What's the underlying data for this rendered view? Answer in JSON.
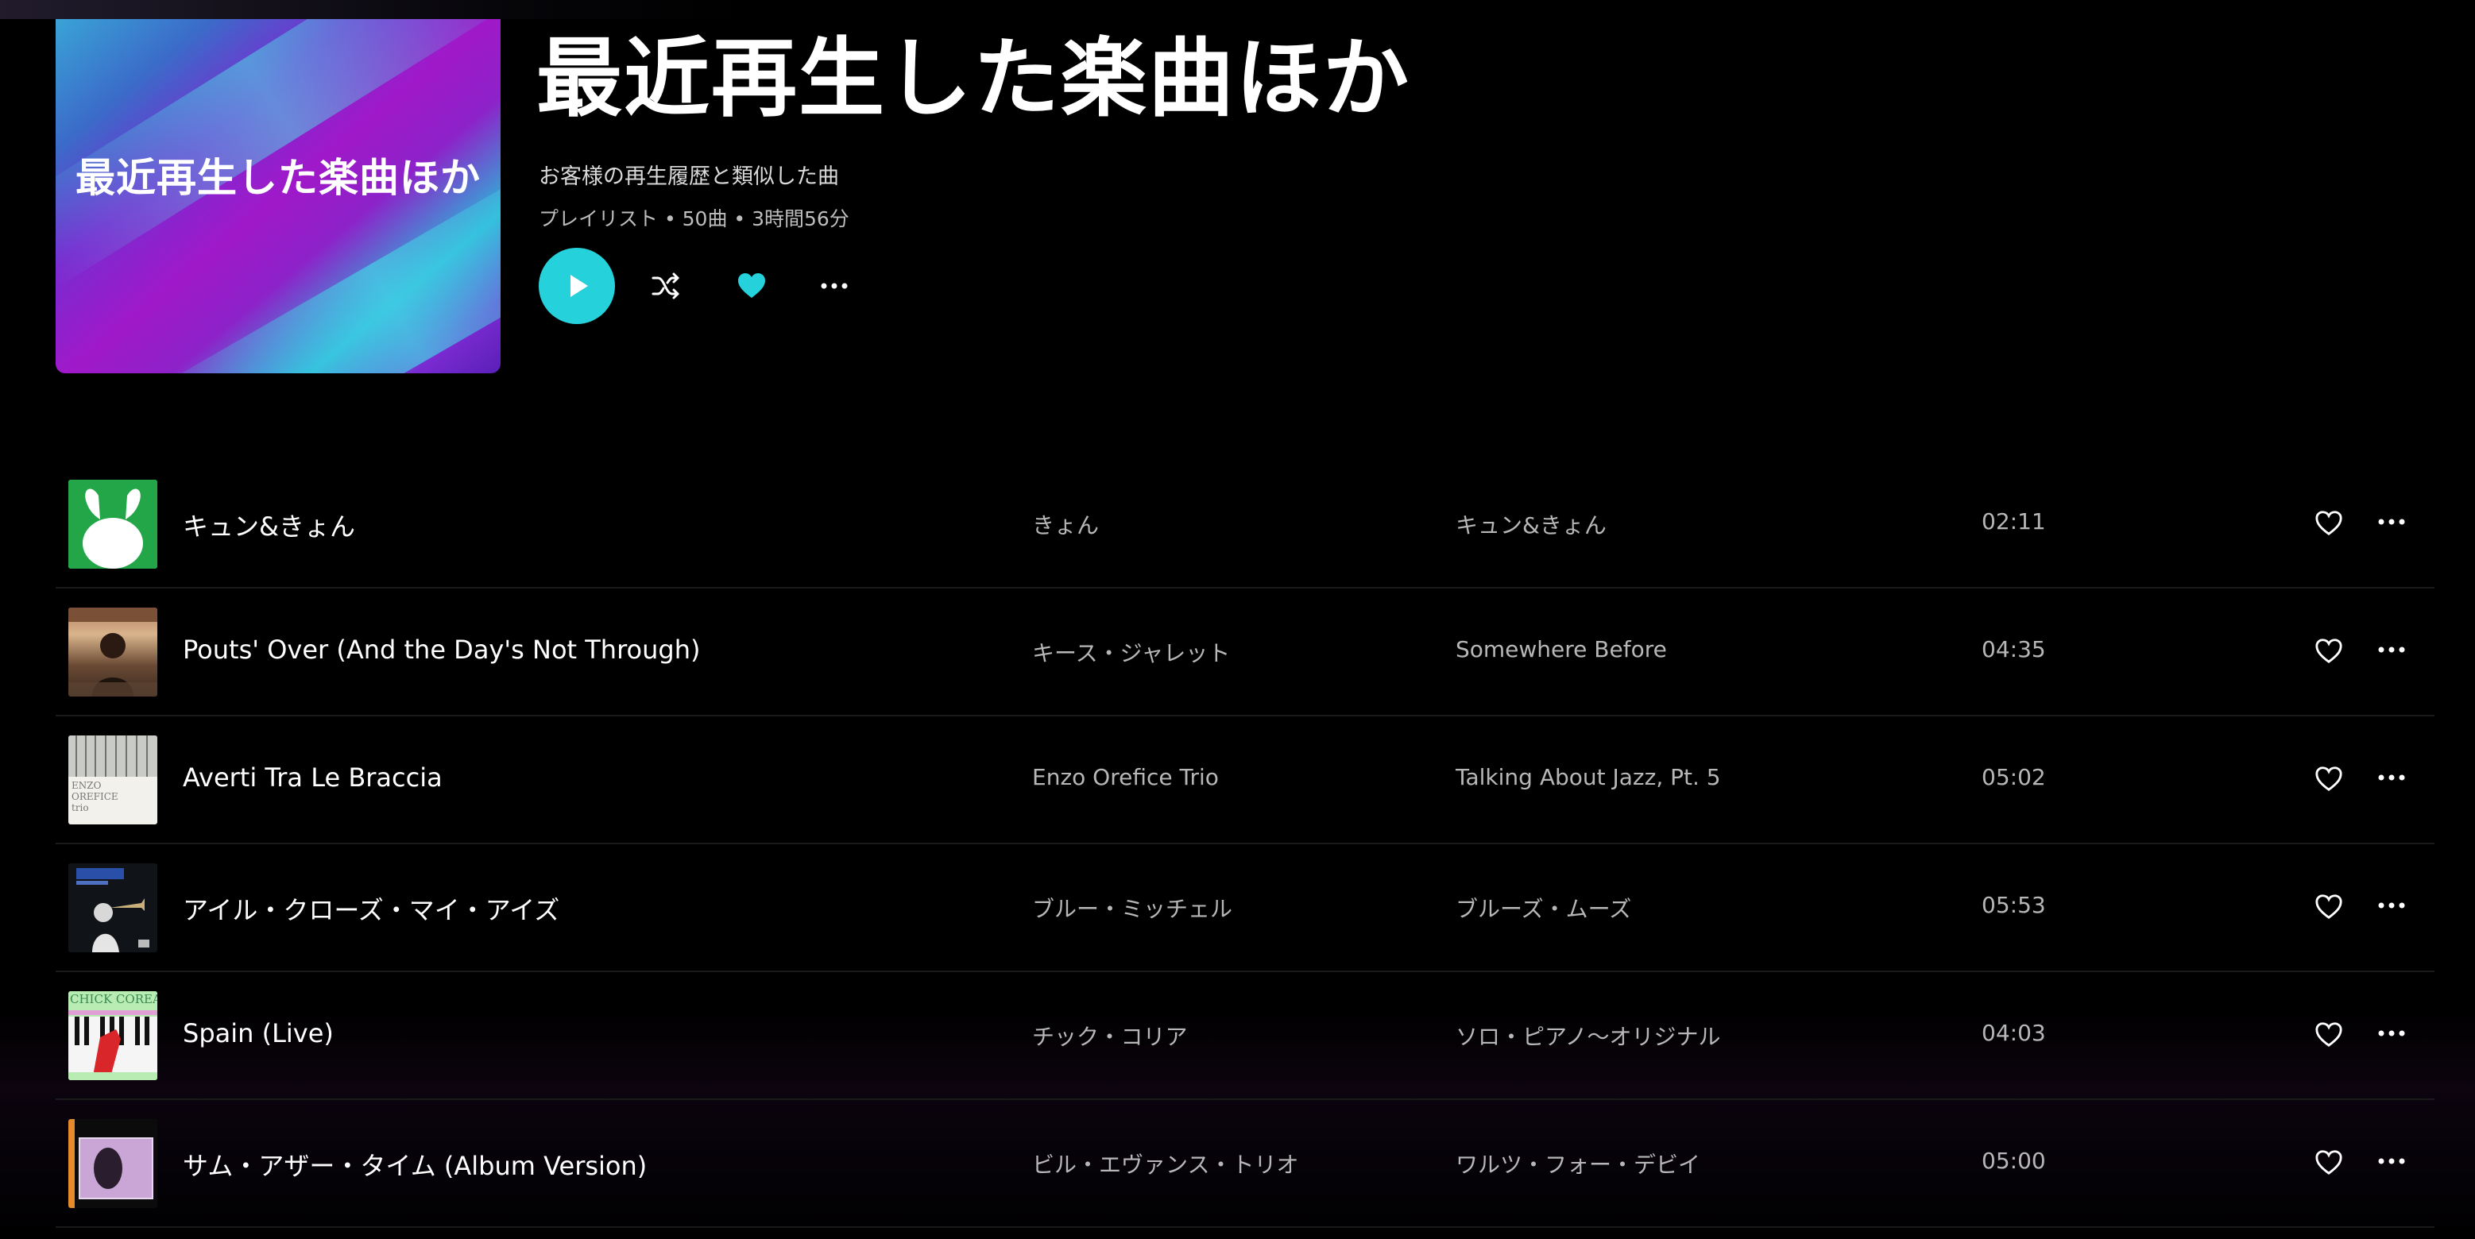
{
  "playlist": {
    "cover_text": "最近再生した楽曲ほか",
    "title": "最近再生した楽曲ほか",
    "subtitle": "お客様の再生履歴と類似した曲",
    "meta": "プレイリスト • 50曲 • 3時間56分"
  },
  "controls": {
    "play_icon": "play-icon",
    "shuffle_icon": "shuffle-icon",
    "favorite_icon": "heart-filled-icon",
    "more_icon": "more-horizontal-icon"
  },
  "colors": {
    "accent": "#25d1da",
    "background": "#000000",
    "secondary_text": "#b7b7b7"
  },
  "tracks": [
    {
      "title": "キュン&きょん",
      "artist": "きょん",
      "album": "キュン&きょん",
      "duration": "02:11"
    },
    {
      "title": "Pouts' Over (And the Day's Not Through)",
      "artist": "キース・ジャレット",
      "album": "Somewhere Before",
      "duration": "04:35"
    },
    {
      "title": "Averti Tra Le Braccia",
      "artist": "Enzo Orefice Trio",
      "album": "Talking About Jazz, Pt. 5",
      "duration": "05:02"
    },
    {
      "title": "アイル・クローズ・マイ・アイズ",
      "artist": "ブルー・ミッチェル",
      "album": "ブルーズ・ムーズ",
      "duration": "05:53"
    },
    {
      "title": "Spain (Live)",
      "artist": "チック・コリア",
      "album": "ソロ・ピアノ〜オリジナル",
      "duration": "04:03"
    },
    {
      "title": "サム・アザー・タイム (Album Version)",
      "artist": "ビル・エヴァンス・トリオ",
      "album": "ワルツ・フォー・デビイ",
      "duration": "05:00"
    }
  ],
  "thumb_texts": {
    "enzo": "ENZO OREFICE trio",
    "chick": "CHICK COREA"
  }
}
